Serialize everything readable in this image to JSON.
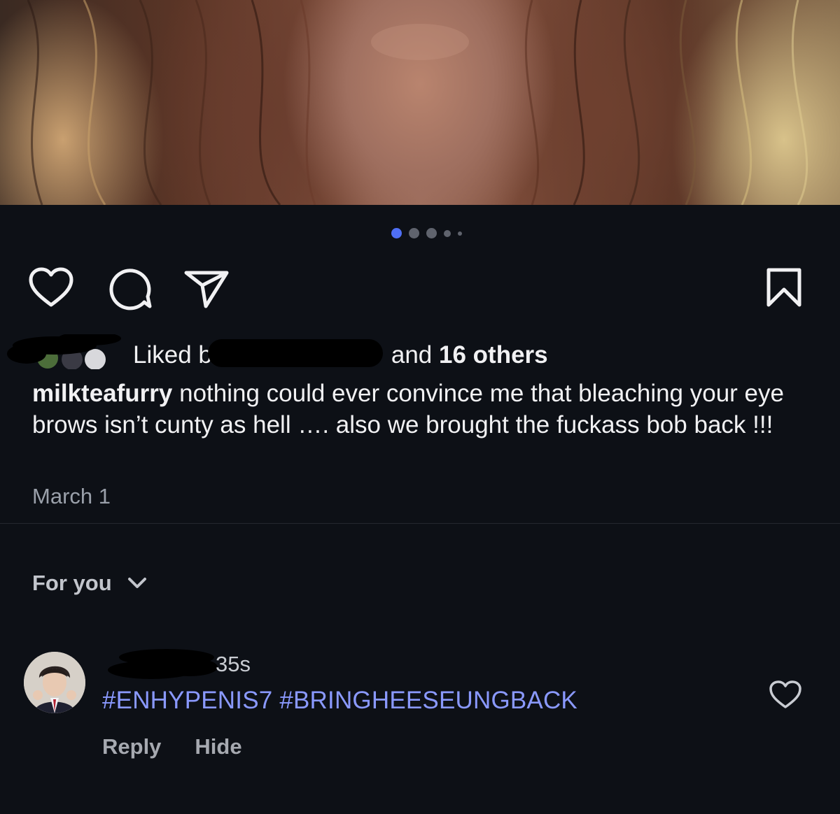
{
  "post": {
    "carousel": {
      "total": 5,
      "active_index": 0
    },
    "likes": {
      "prefix": "Liked b",
      "middle": "and",
      "others": "16 others"
    },
    "caption": {
      "username": "milkteafurry",
      "text": "nothing could ever convince me that bleaching your eye brows isn’t cunty as hell …. also we brought the fuckass bob back !!!"
    },
    "date": "March 1"
  },
  "comments_section": {
    "filter_label": "For you",
    "comments": [
      {
        "time": "35s",
        "text": "#ENHYPENIS7 #BRINGHEESEUNGBACK",
        "reply_label": "Reply",
        "hide_label": "Hide"
      }
    ]
  },
  "icons": {
    "like": "heart-icon",
    "comment": "comment-bubble-icon",
    "share": "send-paper-plane-icon",
    "save": "bookmark-icon",
    "filter": "chevron-down-icon",
    "comment_like": "heart-icon"
  },
  "colors": {
    "background": "#0d1016",
    "active_dot": "#4f6ff5",
    "hashtag": "#8a99ff"
  }
}
